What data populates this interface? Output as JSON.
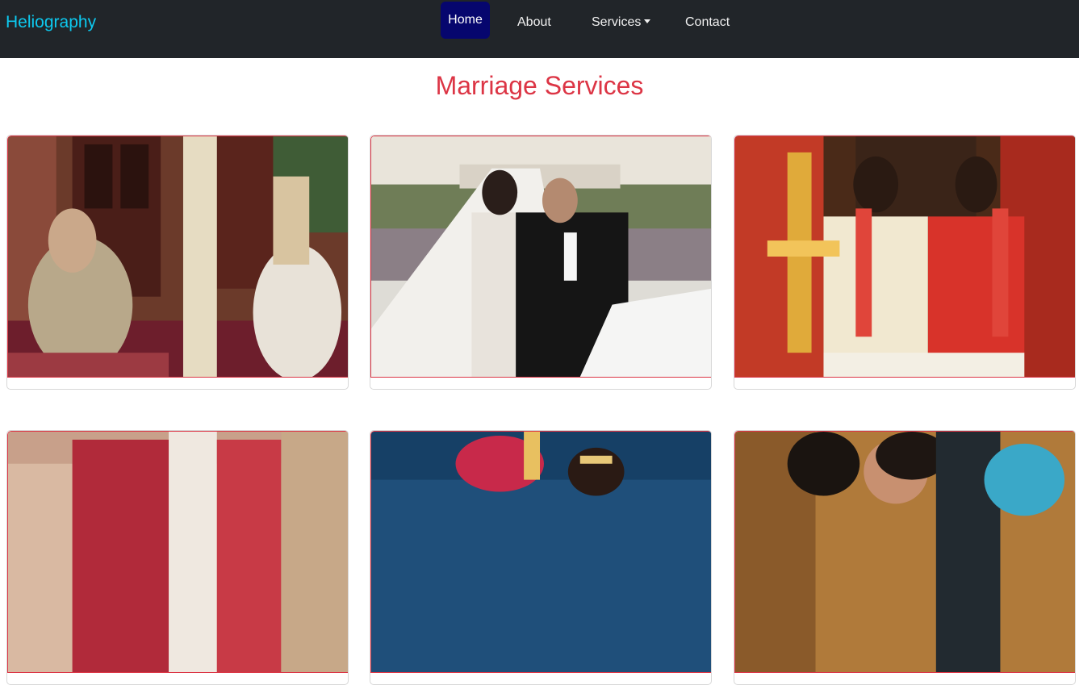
{
  "navbar": {
    "brand": "Heliography",
    "items": [
      {
        "label": "Home",
        "active": true
      },
      {
        "label": "About"
      },
      {
        "label": "Services",
        "dropdown": true
      },
      {
        "label": "Contact"
      }
    ]
  },
  "page": {
    "title": "Marriage Services"
  },
  "gallery": {
    "cards": [
      {
        "image": "bride-and-groom-veiled-ceremony-photo"
      },
      {
        "image": "bride-and-groom-walking-with-long-veil-photo"
      },
      {
        "image": "south-indian-wedding-garlands-lamp-photo"
      },
      {
        "image": "bride-red-attire-photo"
      },
      {
        "image": "groom-red-turban-photo"
      },
      {
        "image": "couple-smiling-photo"
      }
    ]
  },
  "colors": {
    "navbar_bg": "#212529",
    "brand": "#0dcaf0",
    "active_nav_bg": "#06066e",
    "title": "#dc3545",
    "card_border": "#dc3545"
  }
}
